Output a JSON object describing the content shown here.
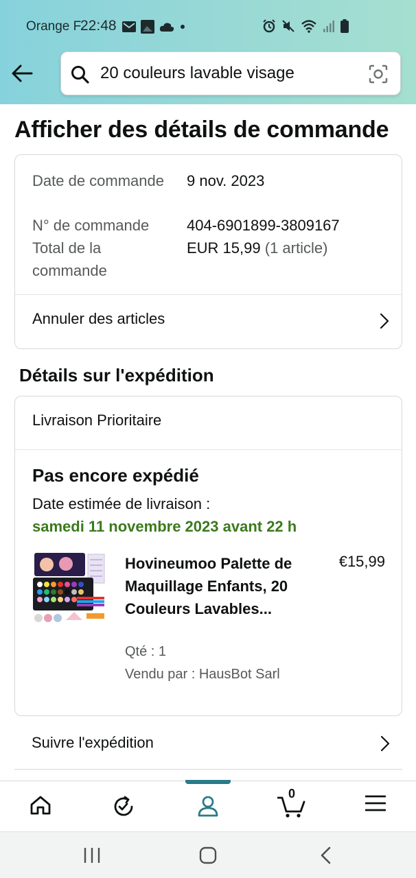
{
  "status_bar": {
    "carrier": "Orange F",
    "time": "22:48",
    "icons_left": [
      "mail-icon",
      "image-icon",
      "cloud-icon",
      "dot-icon"
    ],
    "icons_right": [
      "alarm-icon",
      "mute-icon",
      "wifi-icon",
      "signal-icon",
      "battery-icon"
    ]
  },
  "header": {
    "back_icon": "back-arrow-icon",
    "search": {
      "query": "20 couleurs lavable visage",
      "search_icon": "search-icon",
      "camera_icon": "camera-search-icon"
    }
  },
  "page_title": "Afficher des détails de commande",
  "order_summary": {
    "date_label": "Date de commande",
    "date_value": "9 nov. 2023",
    "number_label": "N° de commande",
    "number_value": "404-6901899-3809167",
    "total_label": "Total de la commande",
    "total_value": "EUR 15,99",
    "total_items": "(1 article)",
    "cancel_link": "Annuler des articles"
  },
  "shipping": {
    "section_title": "Détails sur l'expédition",
    "method": "Livraison Prioritaire",
    "status": "Pas encore expédié",
    "estimate_label": "Date estimée de livraison :",
    "estimate_date": "samedi 11 novembre 2023 avant 22 h",
    "product": {
      "title": "Hovineumoo Palette de Maquillage Enfants, 20 Couleurs Lavables...",
      "price": "€15,99",
      "quantity": "Qté : 1",
      "seller": "Vendu par : HausBot Sarl"
    },
    "track_link": "Suivre l'expédition"
  },
  "bottom_nav": {
    "items": [
      "home-icon",
      "history-icon",
      "account-icon",
      "cart-icon",
      "menu-icon"
    ],
    "active": "account-icon",
    "cart_count": "0"
  },
  "system_nav": [
    "recents-button",
    "home-button",
    "back-button"
  ],
  "colors": {
    "header_gradient_start": "#86d2dc",
    "header_gradient_end": "#a5dfd0",
    "delivery_green": "#3a7a1c",
    "nav_active": "#2a7a8a"
  }
}
